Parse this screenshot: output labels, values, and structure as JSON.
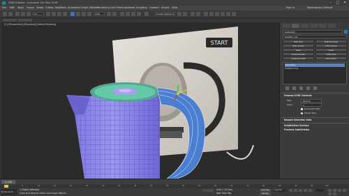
{
  "titlebar": {
    "title": "SAR04-Kettle - Autodesk 3ds Max 2018",
    "minimize": "–",
    "maximize": "□",
    "close": "✕"
  },
  "menubar": {
    "items": [
      "File",
      "Edit",
      "Tools",
      "Group",
      "Views",
      "Create",
      "Modifiers",
      "Animation",
      "Graph Editors",
      "Rendering",
      "Civil View",
      "Customize",
      "Scripting",
      "Content",
      "Arnold",
      "Help"
    ],
    "signin": "Sign In",
    "workspaces": "Workspaces: Default"
  },
  "toolbar": {
    "filter": "All",
    "viewmode": "View",
    "selection_set": "Create Selection Se"
  },
  "viewport": {
    "label": "[+] [Perspective] [Standard] [Default Shading]",
    "backdrop_logo": "START"
  },
  "command_panel": {
    "object_name": "Kettle003",
    "modifier_list": "Modifier List",
    "buttons": [
      "Edit Poly",
      "Edit Normals",
      "FFD 4x4x4",
      "FFD 3x3x3",
      "Shell",
      "Taper",
      "Turbosmooth",
      "UVW Map",
      "Unwrap UVW",
      "Symmetry"
    ],
    "stack": [
      "Symmetry",
      "Editable Poly"
    ],
    "rollout_1": "Unwrap UVW Controls",
    "fields": [
      {
        "label": "Map:",
        "value": "Normal"
      },
      {
        "label": "Align:",
        "value": "X"
      },
      {
        "label": "",
        "value": "Normalize Map"
      },
      {
        "label": "",
        "value": "Planar Map"
      }
    ],
    "rollout_2": "Named Selection Sets",
    "rollout_3": "Subdivision Surface",
    "rollout_4": "Preview Subdivision"
  },
  "timeline": {
    "frame_counter": "0 / 100",
    "ticks": [
      "0",
      "5",
      "10",
      "15",
      "20",
      "25",
      "30",
      "35",
      "40",
      "45",
      "50",
      "55",
      "60",
      "65",
      "70",
      "75",
      "80",
      "85",
      "90",
      "95",
      "100"
    ]
  },
  "statusbar": {
    "selection": "1 Object Selected",
    "prompt": "Click and drag to select and move objects",
    "maxscript": "MAXScript Mi",
    "add_time_tag": "Add Time Tag",
    "grid": "Grid = 10.0cm",
    "auto_key": "Auto Key",
    "set_key": "Set Key",
    "key_filter": "Selected"
  },
  "colors": {
    "viewport_bg": "#2b2b2b",
    "kettle_body": "#8b86e8",
    "kettle_lid": "#3cbf9a",
    "accent": "#3a73b8"
  }
}
